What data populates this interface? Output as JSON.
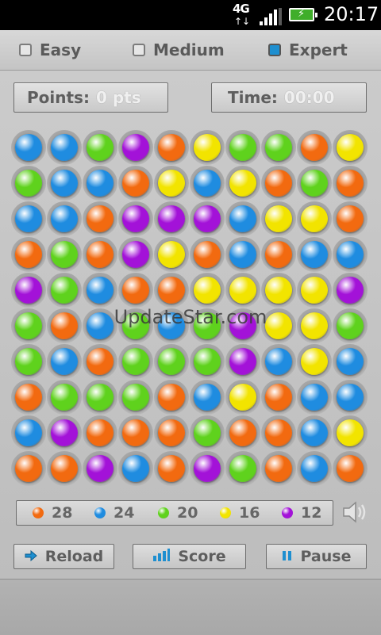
{
  "status_bar": {
    "network": "4G",
    "time": "20:17"
  },
  "modes": [
    {
      "label": "Easy",
      "checked": false
    },
    {
      "label": "Medium",
      "checked": false
    },
    {
      "label": "Expert",
      "checked": true
    }
  ],
  "points": {
    "label": "Points:",
    "value": "0 pts"
  },
  "time": {
    "label": "Time:",
    "value": "00:00"
  },
  "colors": {
    "O": "#f26a10",
    "B": "#1f8ce0",
    "G": "#5fd21d",
    "Y": "#f2e400",
    "P": "#a312d8"
  },
  "board": [
    [
      "B",
      "B",
      "G",
      "P",
      "O",
      "Y",
      "G",
      "G",
      "O",
      "Y"
    ],
    [
      "G",
      "B",
      "B",
      "O",
      "Y",
      "B",
      "Y",
      "O",
      "G",
      "O"
    ],
    [
      "B",
      "B",
      "O",
      "P",
      "P",
      "P",
      "B",
      "Y",
      "Y",
      "O"
    ],
    [
      "O",
      "G",
      "O",
      "P",
      "Y",
      "O",
      "B",
      "O",
      "B",
      "B"
    ],
    [
      "P",
      "G",
      "B",
      "O",
      "O",
      "Y",
      "Y",
      "Y",
      "Y",
      "P"
    ],
    [
      "G",
      "O",
      "B",
      "G",
      "B",
      "G",
      "P",
      "Y",
      "Y",
      "G"
    ],
    [
      "G",
      "B",
      "O",
      "G",
      "G",
      "G",
      "P",
      "B",
      "Y",
      "B"
    ],
    [
      "O",
      "G",
      "G",
      "G",
      "O",
      "B",
      "Y",
      "O",
      "B",
      "B"
    ],
    [
      "B",
      "P",
      "O",
      "O",
      "O",
      "G",
      "O",
      "O",
      "B",
      "Y"
    ],
    [
      "O",
      "O",
      "P",
      "B",
      "O",
      "P",
      "G",
      "O",
      "B",
      "O"
    ]
  ],
  "counts": [
    {
      "color": "O",
      "value": "28"
    },
    {
      "color": "B",
      "value": "24"
    },
    {
      "color": "G",
      "value": "20"
    },
    {
      "color": "Y",
      "value": "16"
    },
    {
      "color": "P",
      "value": "12"
    }
  ],
  "buttons": {
    "reload": "Reload",
    "score": "Score",
    "pause": "Pause"
  },
  "watermark": "UpdateStar.com"
}
